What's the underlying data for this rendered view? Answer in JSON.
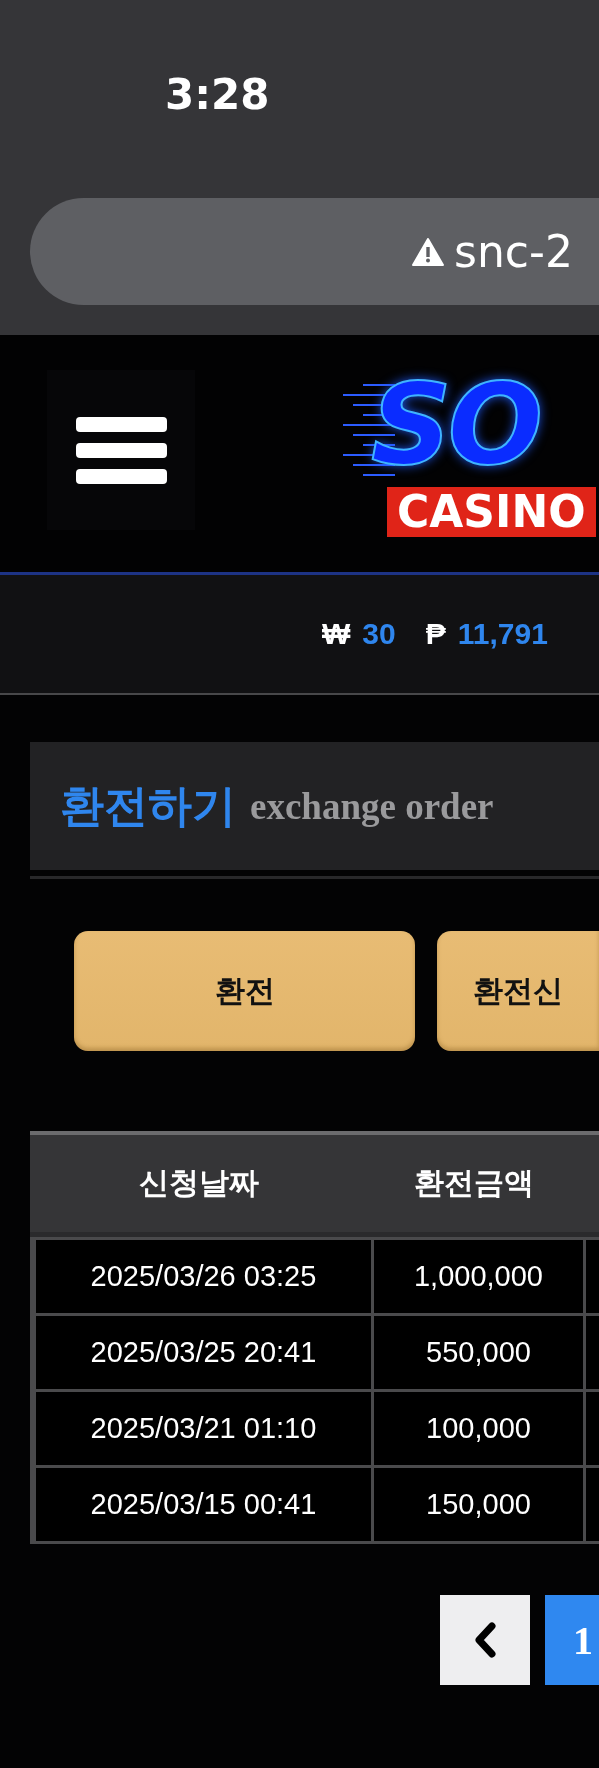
{
  "status_bar": {
    "time": "3:28"
  },
  "address_bar": {
    "url": "snc-2"
  },
  "header": {
    "logo": {
      "title": "SO",
      "subtitle": "CASINO"
    }
  },
  "balance": [
    {
      "symbol": "₩",
      "amount": "30"
    },
    {
      "symbol": "₱",
      "amount": "11,791"
    }
  ],
  "section": {
    "title": "환전하기",
    "subtitle": "exchange order"
  },
  "buttons": [
    "환전",
    "환전신"
  ],
  "table": {
    "columns": [
      "신청날짜",
      "환전금액"
    ],
    "rows": [
      [
        "2025/03/26 03:25",
        "1,000,000"
      ],
      [
        "2025/03/25 20:41",
        "550,000"
      ],
      [
        "2025/03/21 01:10",
        "100,000"
      ],
      [
        "2025/03/15 00:41",
        "150,000"
      ]
    ]
  },
  "pagination": {
    "pages": [
      {
        "label": "1",
        "selected": true
      }
    ]
  }
}
